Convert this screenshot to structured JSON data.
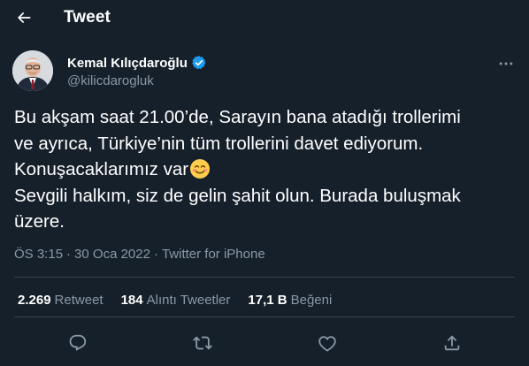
{
  "header": {
    "title": "Tweet"
  },
  "author": {
    "name": "Kemal Kılıçdaroğlu",
    "handle": "@kilicdarogluk"
  },
  "tweet": {
    "lines": [
      "Bu akşam saat 21.00’de, Sarayın bana atadığı trollerimi",
      "ve ayrıca, Türkiye’nin tüm trollerini davet ediyorum.",
      "Konuşacaklarımız var",
      "Sevgili halkım, siz de gelin şahit olun. Burada buluşmak",
      "üzere."
    ],
    "emoji": "smiling-face-with-smiling-eyes"
  },
  "meta": {
    "time": "ÖS 3:15",
    "separator1": "·",
    "date": "30 Oca 2022",
    "separator2": "·",
    "source": "Twitter for iPhone"
  },
  "stats": {
    "retweets": {
      "count": "2.269",
      "label": "Retweet"
    },
    "quotes": {
      "count": "184",
      "label": "Alıntı Tweetler"
    },
    "likes": {
      "count": "17,1 B",
      "label": "Beğeni"
    }
  },
  "colors": {
    "background": "#15202b",
    "text_primary": "#ffffff",
    "text_secondary": "#8b98a5",
    "divider": "#38444d",
    "verified": "#1d9bf0"
  },
  "icons": {
    "back": "arrow-left-icon",
    "verified": "verified-badge-icon",
    "more": "more-horizontal-icon",
    "reply": "reply-icon",
    "retweet": "retweet-icon",
    "like": "heart-icon",
    "share": "share-icon"
  }
}
